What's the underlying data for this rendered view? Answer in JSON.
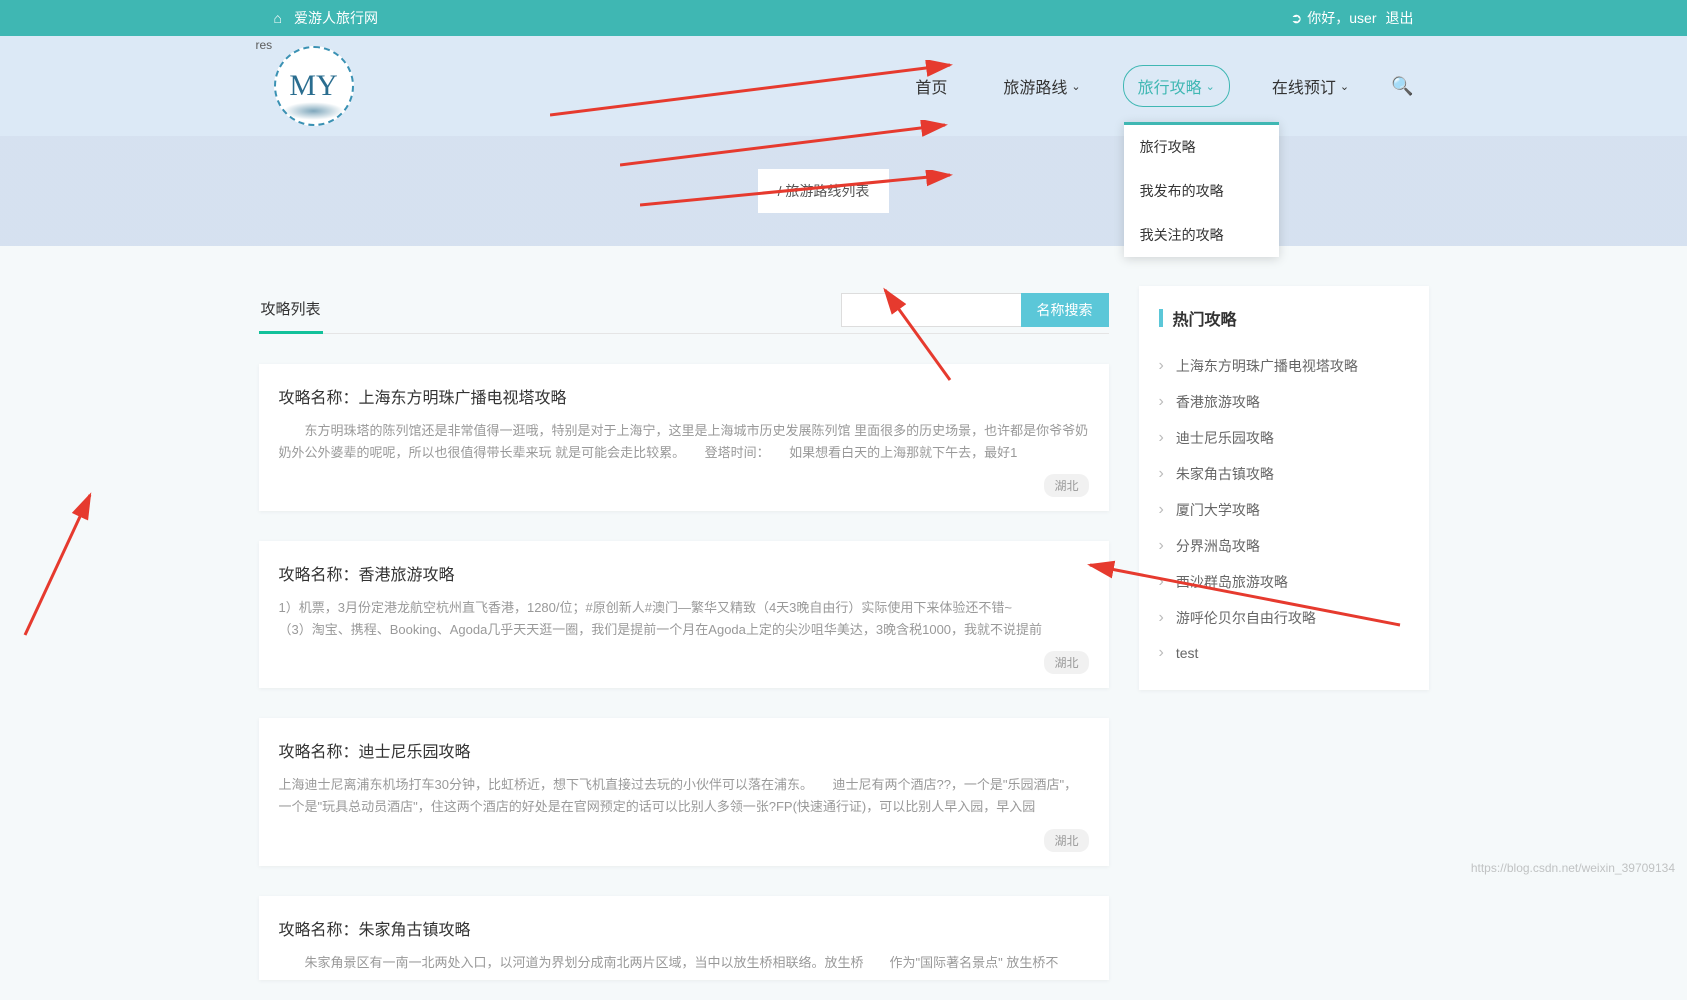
{
  "topbar": {
    "site_name": "爱游人旅行网",
    "greeting": "你好，user",
    "logout": "退出"
  },
  "logo": {
    "text": "MY",
    "badge": "res"
  },
  "nav": {
    "home": "首页",
    "routes": "旅游路线",
    "guides": "旅行攻略",
    "booking": "在线预订"
  },
  "dropdown": {
    "item1": "旅行攻略",
    "item2": "我发布的攻略",
    "item3": "我关注的攻略"
  },
  "breadcrumb": "/  旅游路线列表",
  "tab": {
    "title": "攻略列表"
  },
  "search": {
    "btn": "名称搜索"
  },
  "articles": [
    {
      "title": "攻略名称：上海东方明珠广播电视塔攻略",
      "desc": "　　东方明珠塔的陈列馆还是非常值得一逛哦，特别是对于上海宁，这里是上海城市历史发展陈列馆 里面很多的历史场景，也许都是你爷爷奶奶外公外婆辈的呢呢，所以也很值得带长辈来玩 就是可能会走比较累。　　登塔时间：　　如果想看白天的上海那就下午去，最好1",
      "tag": "湖北"
    },
    {
      "title": "攻略名称：香港旅游攻略",
      "desc": "1）机票，3月份定港龙航空杭州直飞香港，1280/位；#原创新人#澳门—繁华又精致（4天3晚自由行）实际使用下来体验还不错~　　　　　　（3）淘宝、携程、Booking、Agoda几乎天天逛一圈，我们是提前一个月在Agoda上定的尖沙咀华美达，3晚含税1000，我就不说提前",
      "tag": "湖北"
    },
    {
      "title": "攻略名称：迪士尼乐园攻略",
      "desc": "上海迪士尼离浦东机场打车30分钟，比虹桥近，想下飞机直接过去玩的小伙伴可以落在浦东。　　迪士尼有两个酒店??，一个是\"乐园酒店\"，一个是\"玩具总动员酒店\"，住这两个酒店的好处是在官网预定的话可以比别人多领一张?FP(快速通行证)，可以比别人早入园，早入园",
      "tag": "湖北"
    },
    {
      "title": "攻略名称：朱家角古镇攻略",
      "desc": "　　朱家角景区有一南一北两处入口，以河道为界划分成南北两片区域，当中以放生桥相联络。放生桥　　作为\"国际著名景点\"  放生桥不",
      "tag": ""
    }
  ],
  "sidebar": {
    "title": "热门攻略",
    "items": [
      "上海东方明珠广播电视塔攻略",
      "香港旅游攻略",
      "迪士尼乐园攻略",
      "朱家角古镇攻略",
      "厦门大学攻略",
      "分界洲岛攻略",
      "西沙群岛旅游攻略",
      "游呼伦贝尔自由行攻略",
      "test"
    ]
  },
  "watermark": "https://blog.csdn.net/weixin_39709134"
}
